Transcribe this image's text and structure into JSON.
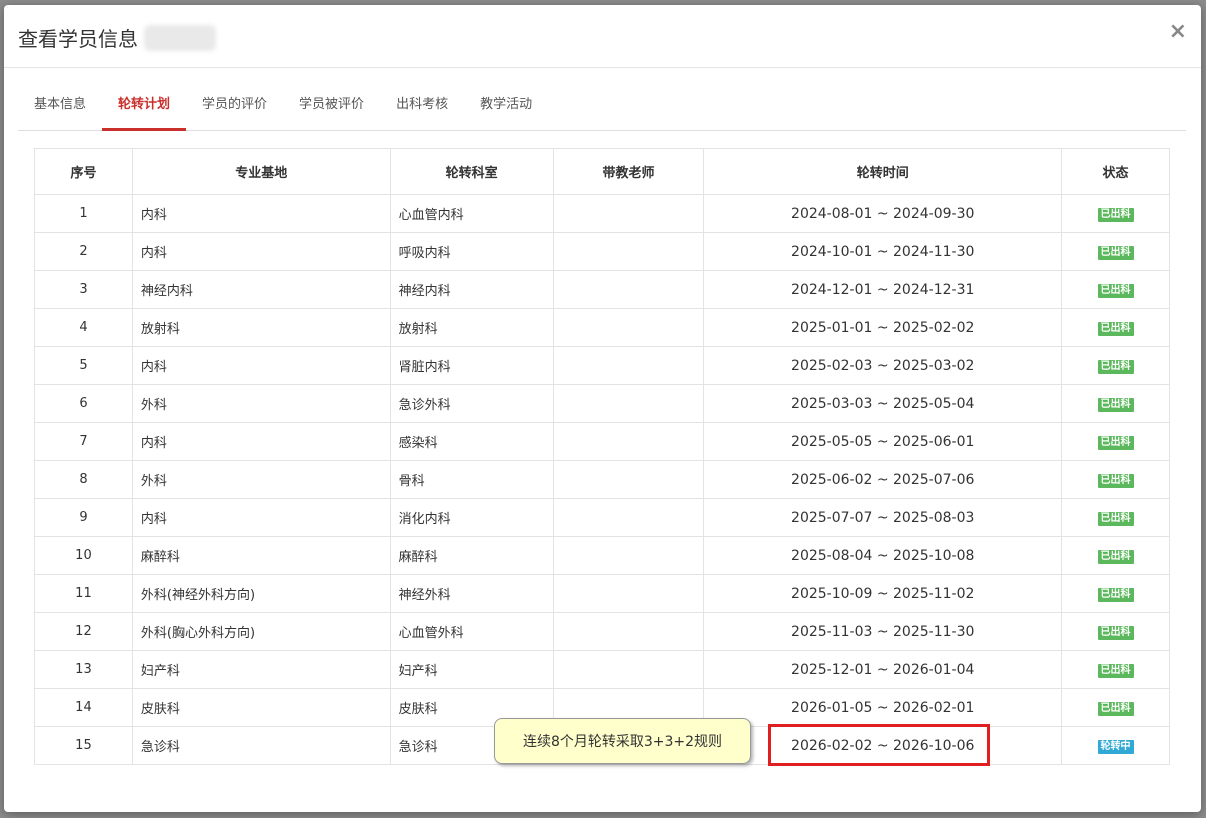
{
  "modal": {
    "title": "查看学员信息",
    "close_label": "×"
  },
  "tabs": [
    {
      "label": "基本信息",
      "active": false
    },
    {
      "label": "轮转计划",
      "active": true
    },
    {
      "label": "学员的评价",
      "active": false
    },
    {
      "label": "学员被评价",
      "active": false
    },
    {
      "label": "出科考核",
      "active": false
    },
    {
      "label": "教学活动",
      "active": false
    }
  ],
  "table": {
    "headers": [
      "序号",
      "专业基地",
      "轮转科室",
      "带教老师",
      "轮转时间",
      "状态"
    ],
    "rows": [
      {
        "no": "1",
        "base": "内科",
        "dept": "心血管内科",
        "teacher": "",
        "time": "2024-08-01 ~ 2024-09-30",
        "status": "已出科",
        "status_type": "done"
      },
      {
        "no": "2",
        "base": "内科",
        "dept": "呼吸内科",
        "teacher": "",
        "time": "2024-10-01 ~ 2024-11-30",
        "status": "已出科",
        "status_type": "done"
      },
      {
        "no": "3",
        "base": "神经内科",
        "dept": "神经内科",
        "teacher": "",
        "time": "2024-12-01 ~ 2024-12-31",
        "status": "已出科",
        "status_type": "done"
      },
      {
        "no": "4",
        "base": "放射科",
        "dept": "放射科",
        "teacher": "",
        "time": "2025-01-01 ~ 2025-02-02",
        "status": "已出科",
        "status_type": "done"
      },
      {
        "no": "5",
        "base": "内科",
        "dept": "肾脏内科",
        "teacher": "",
        "time": "2025-02-03 ~ 2025-03-02",
        "status": "已出科",
        "status_type": "done"
      },
      {
        "no": "6",
        "base": "外科",
        "dept": "急诊外科",
        "teacher": "",
        "time": "2025-03-03 ~ 2025-05-04",
        "status": "已出科",
        "status_type": "done"
      },
      {
        "no": "7",
        "base": "内科",
        "dept": "感染科",
        "teacher": "",
        "time": "2025-05-05 ~ 2025-06-01",
        "status": "已出科",
        "status_type": "done"
      },
      {
        "no": "8",
        "base": "外科",
        "dept": "骨科",
        "teacher": "",
        "time": "2025-06-02 ~ 2025-07-06",
        "status": "已出科",
        "status_type": "done"
      },
      {
        "no": "9",
        "base": "内科",
        "dept": "消化内科",
        "teacher": "",
        "time": "2025-07-07 ~ 2025-08-03",
        "status": "已出科",
        "status_type": "done"
      },
      {
        "no": "10",
        "base": "麻醉科",
        "dept": "麻醉科",
        "teacher": "",
        "time": "2025-08-04 ~ 2025-10-08",
        "status": "已出科",
        "status_type": "done"
      },
      {
        "no": "11",
        "base": "外科(神经外科方向)",
        "dept": "神经外科",
        "teacher": "",
        "time": "2025-10-09 ~ 2025-11-02",
        "status": "已出科",
        "status_type": "done"
      },
      {
        "no": "12",
        "base": "外科(胸心外科方向)",
        "dept": "心血管外科",
        "teacher": "",
        "time": "2025-11-03 ~ 2025-11-30",
        "status": "已出科",
        "status_type": "done"
      },
      {
        "no": "13",
        "base": "妇产科",
        "dept": "妇产科",
        "teacher": "",
        "time": "2025-12-01 ~ 2026-01-04",
        "status": "已出科",
        "status_type": "done"
      },
      {
        "no": "14",
        "base": "皮肤科",
        "dept": "皮肤科",
        "teacher": "",
        "time": "2026-01-05 ~ 2026-02-01",
        "status": "已出科",
        "status_type": "done"
      },
      {
        "no": "15",
        "base": "急诊科",
        "dept": "急诊科",
        "teacher": "",
        "time": "2026-02-02 ~ 2026-10-06",
        "status": "轮转中",
        "status_type": "rotating"
      }
    ]
  },
  "annotation": {
    "tooltip_text": "连续8个月轮转采取3+3+2规则"
  },
  "colors": {
    "accent": "#c9302c",
    "status_done": "#5cb85c",
    "status_rotating": "#31a9d5",
    "highlight": "#e02020"
  }
}
